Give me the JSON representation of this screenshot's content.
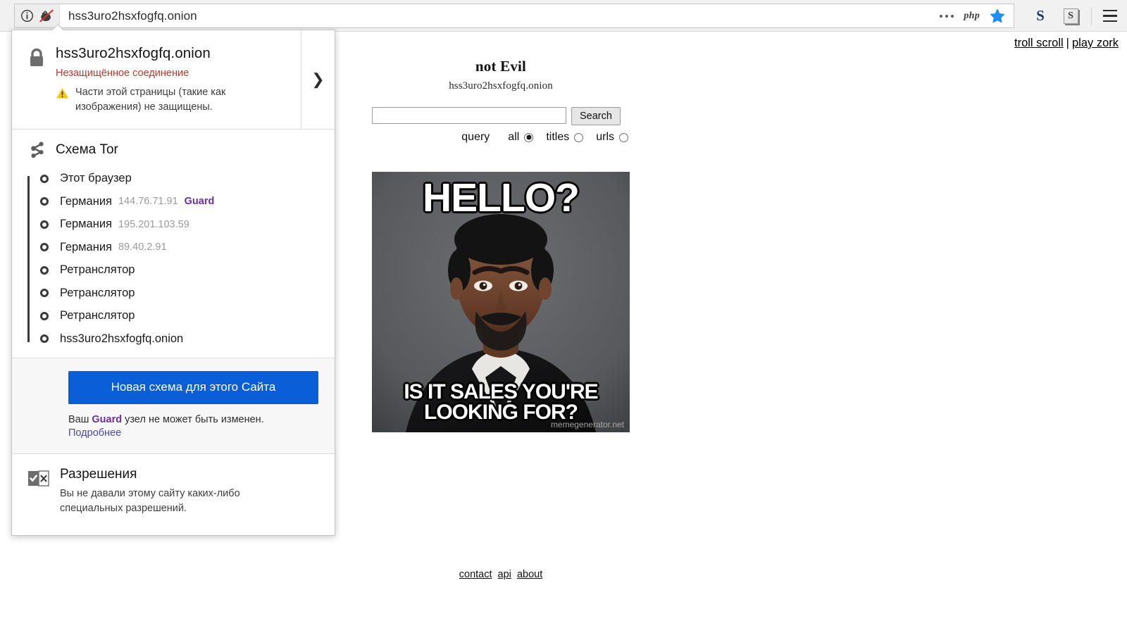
{
  "browser": {
    "url": "hss3uro2hsxfogfq.onion",
    "identity_icons": [
      "info-icon",
      "onion-broken-icon"
    ],
    "toolbar_icons": [
      "more-dots-icon",
      "php-badge-icon",
      "bookmark-star-icon"
    ],
    "php_badge": "php",
    "extension_icons": [
      "stylish-s-icon",
      "scriptsafe-s-icon"
    ],
    "ext_one_label": "S",
    "ext_two_label": "S",
    "menu_icon": "hamburger-menu-icon"
  },
  "panel": {
    "security": {
      "host": "hss3uro2hsxfogfq.onion",
      "connection_status": "Незащищённое соединение",
      "mixed_content_warning": "Части этой страницы (такие как изображения) не защищены.",
      "expand_icon": "chevron-right-icon",
      "lock_icon": "lock-icon",
      "warning_icon": "warning-triangle-icon"
    },
    "circuit": {
      "title": "Схема Tor",
      "icon": "tor-circuit-icon",
      "nodes": [
        {
          "name": "Этот браузер",
          "ip": "",
          "badge": ""
        },
        {
          "name": "Германия",
          "ip": "144.76.71.91",
          "badge": "Guard"
        },
        {
          "name": "Германия",
          "ip": "195.201.103.59",
          "badge": ""
        },
        {
          "name": "Германия",
          "ip": "89.40.2.91",
          "badge": ""
        },
        {
          "name": "Ретранслятор",
          "ip": "",
          "badge": ""
        },
        {
          "name": "Ретранслятор",
          "ip": "",
          "badge": ""
        },
        {
          "name": "Ретранслятор",
          "ip": "",
          "badge": ""
        },
        {
          "name": "hss3uro2hsxfogfq.onion",
          "ip": "",
          "badge": ""
        }
      ]
    },
    "new_circuit": {
      "button_label": "Новая схема для этого Сайта",
      "note_prefix": "Ваш ",
      "note_badge": "Guard",
      "note_suffix": " узел не может быть изменен.",
      "learn_more": "Подробнее"
    },
    "permissions": {
      "title": "Разрешения",
      "text": "Вы не давали этому сайту каких-либо специальных разрешений.",
      "icon": "permissions-checkbox-icon"
    }
  },
  "page": {
    "top_links": {
      "troll_scroll": "troll scroll",
      "separator": "|",
      "play_zork": "play zork"
    },
    "title": "not Evil",
    "subtitle": "hss3uro2hsxfogfq.onion",
    "search": {
      "value": "",
      "placeholder": "",
      "button_label": "Search",
      "scope_label": "query",
      "options": [
        {
          "label": "all",
          "checked": true
        },
        {
          "label": "titles",
          "checked": false
        },
        {
          "label": "urls",
          "checked": false
        }
      ]
    },
    "meme": {
      "top_text": "HELLO?",
      "bottom_text": "IS IT SALES YOU'RE LOOKING FOR?",
      "watermark": "memegenerator.net",
      "alt": "lionel-richie-hello-meme"
    },
    "footer": {
      "contact": "contact",
      "api": "api",
      "about": "about"
    }
  },
  "colors": {
    "accent_blue": "#0a5fd8",
    "insecure_red": "#c0392b",
    "guard_purple": "#6b2fa0",
    "link_blue": "#4a4aa8",
    "warning_yellow": "#f5c518"
  }
}
